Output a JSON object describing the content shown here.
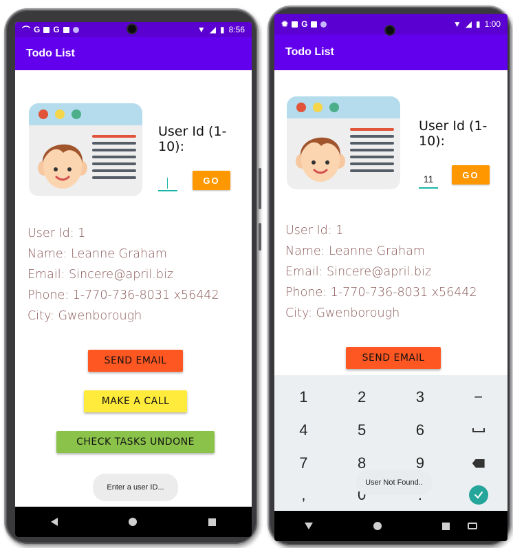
{
  "app": {
    "title": "Todo List",
    "accent_color": "#6200ee",
    "status_bar_color": "#5a00d1"
  },
  "left_screen": {
    "status": {
      "icons": [
        "phone-missed-icon",
        "google-icon",
        "news-icon",
        "google-icon",
        "sd-card-icon",
        "dot-icon"
      ],
      "time": "8:56"
    },
    "user_id_label": "User Id (1-10):",
    "user_id_value": "",
    "go_label": "GO",
    "user": {
      "id": "User Id: 1",
      "name": "Name: Leanne Graham",
      "email": "Email: Sincere@april.biz",
      "phone": "Phone: 1-770-736-8031 x56442",
      "city": "City: Gwenborough"
    },
    "send_email_label": "SEND EMAIL",
    "make_call_label": "MAKE A CALL",
    "check_tasks_label": "CHECK TASKS UNDONE",
    "toast": "Enter a user ID..."
  },
  "right_screen": {
    "status": {
      "icons": [
        "gear-icon",
        "news-icon",
        "google-icon",
        "sd-card-icon",
        "dot-icon"
      ],
      "time": "1:00"
    },
    "user_id_label": "User Id (1-10):",
    "user_id_value": "11",
    "go_label": "GO",
    "user": {
      "id": "User Id: 1",
      "name": "Name: Leanne Graham",
      "email": "Email: Sincere@april.biz",
      "phone": "Phone: 1-770-736-8031 x56442",
      "city": "City: Gwenborough"
    },
    "send_email_label": "SEND EMAIL",
    "toast": "User Not Found..",
    "keypad": {
      "k1": "1",
      "k2": "2",
      "k3": "3",
      "minus": "−",
      "k4": "4",
      "k5": "5",
      "k6": "6",
      "k7": "7",
      "k8": "8",
      "k9": "9",
      "comma": ",",
      "k0": "0",
      "dot": "."
    }
  },
  "colors": {
    "go": "#ff9800",
    "send_email": "#ff5722",
    "make_call": "#ffeb3b",
    "check_tasks": "#8bc34a",
    "input_underline": "#17b5a6"
  }
}
